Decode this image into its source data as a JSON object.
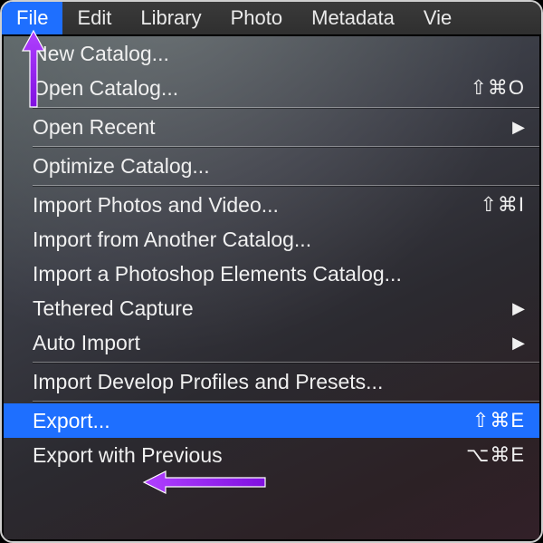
{
  "menubar": {
    "file": "File",
    "edit": "Edit",
    "library": "Library",
    "photo": "Photo",
    "metadata": "Metadata",
    "view": "Vie"
  },
  "menu": {
    "new_catalog": "New Catalog...",
    "open_catalog": "Open Catalog...",
    "open_catalog_shortcut": "⇧⌘O",
    "open_recent": "Open Recent",
    "optimize_catalog": "Optimize Catalog...",
    "import_photos": "Import Photos and Video...",
    "import_photos_shortcut": "⇧⌘I",
    "import_from_catalog": "Import from Another Catalog...",
    "import_pse_catalog": "Import a Photoshop Elements Catalog...",
    "tethered_capture": "Tethered Capture",
    "auto_import": "Auto Import",
    "import_dev_profiles": "Import Develop Profiles and Presets...",
    "export": "Export...",
    "export_shortcut": "⇧⌘E",
    "export_with_previous": "Export with Previous",
    "export_with_previous_shortcut": "⌥⌘E"
  },
  "glyphs": {
    "submenu_arrow": "▶"
  },
  "colors": {
    "highlight": "#1e6fff",
    "annotation": "#a020f0"
  }
}
